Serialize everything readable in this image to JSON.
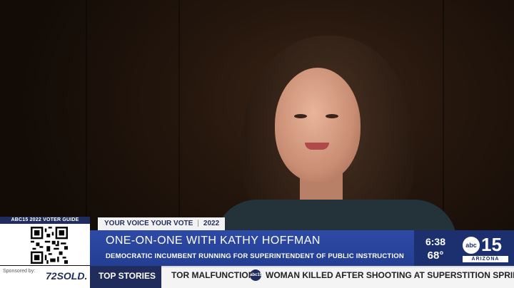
{
  "broadcast": {
    "voter_guide_label": "ABC15 2022 VOTER GUIDE",
    "segment_tag": "YOUR VOICE YOUR VOTE",
    "segment_year": "2022",
    "headline": "ONE-ON-ONE WITH KATHY HOFFMAN",
    "subheadline": "DEMOCRATIC INCUMBENT RUNNING FOR SUPERINTENDENT OF PUBLIC INSTRUCTION",
    "time": "6:38",
    "temperature": "68°",
    "station": {
      "network": "abc",
      "number": "15",
      "region": "ARIZONA"
    }
  },
  "ticker": {
    "sponsor_label": "Sponsored by:",
    "sponsor_brand": "72SOLD.",
    "section_label": "TOP STORIES",
    "items": [
      "TOR MALFUNCTION",
      "WOMAN KILLED AFTER SHOOTING AT SUPERSTITION SPRINGS"
    ],
    "separator_logo": "abc15"
  },
  "icons": {
    "qr": "qr-code-icon",
    "station_logo": "abc15-logo-icon"
  },
  "colors": {
    "navy": "#1f2c5c",
    "headline_blue": "#2d4aa6",
    "weather_blue": "#1c2f6e"
  }
}
